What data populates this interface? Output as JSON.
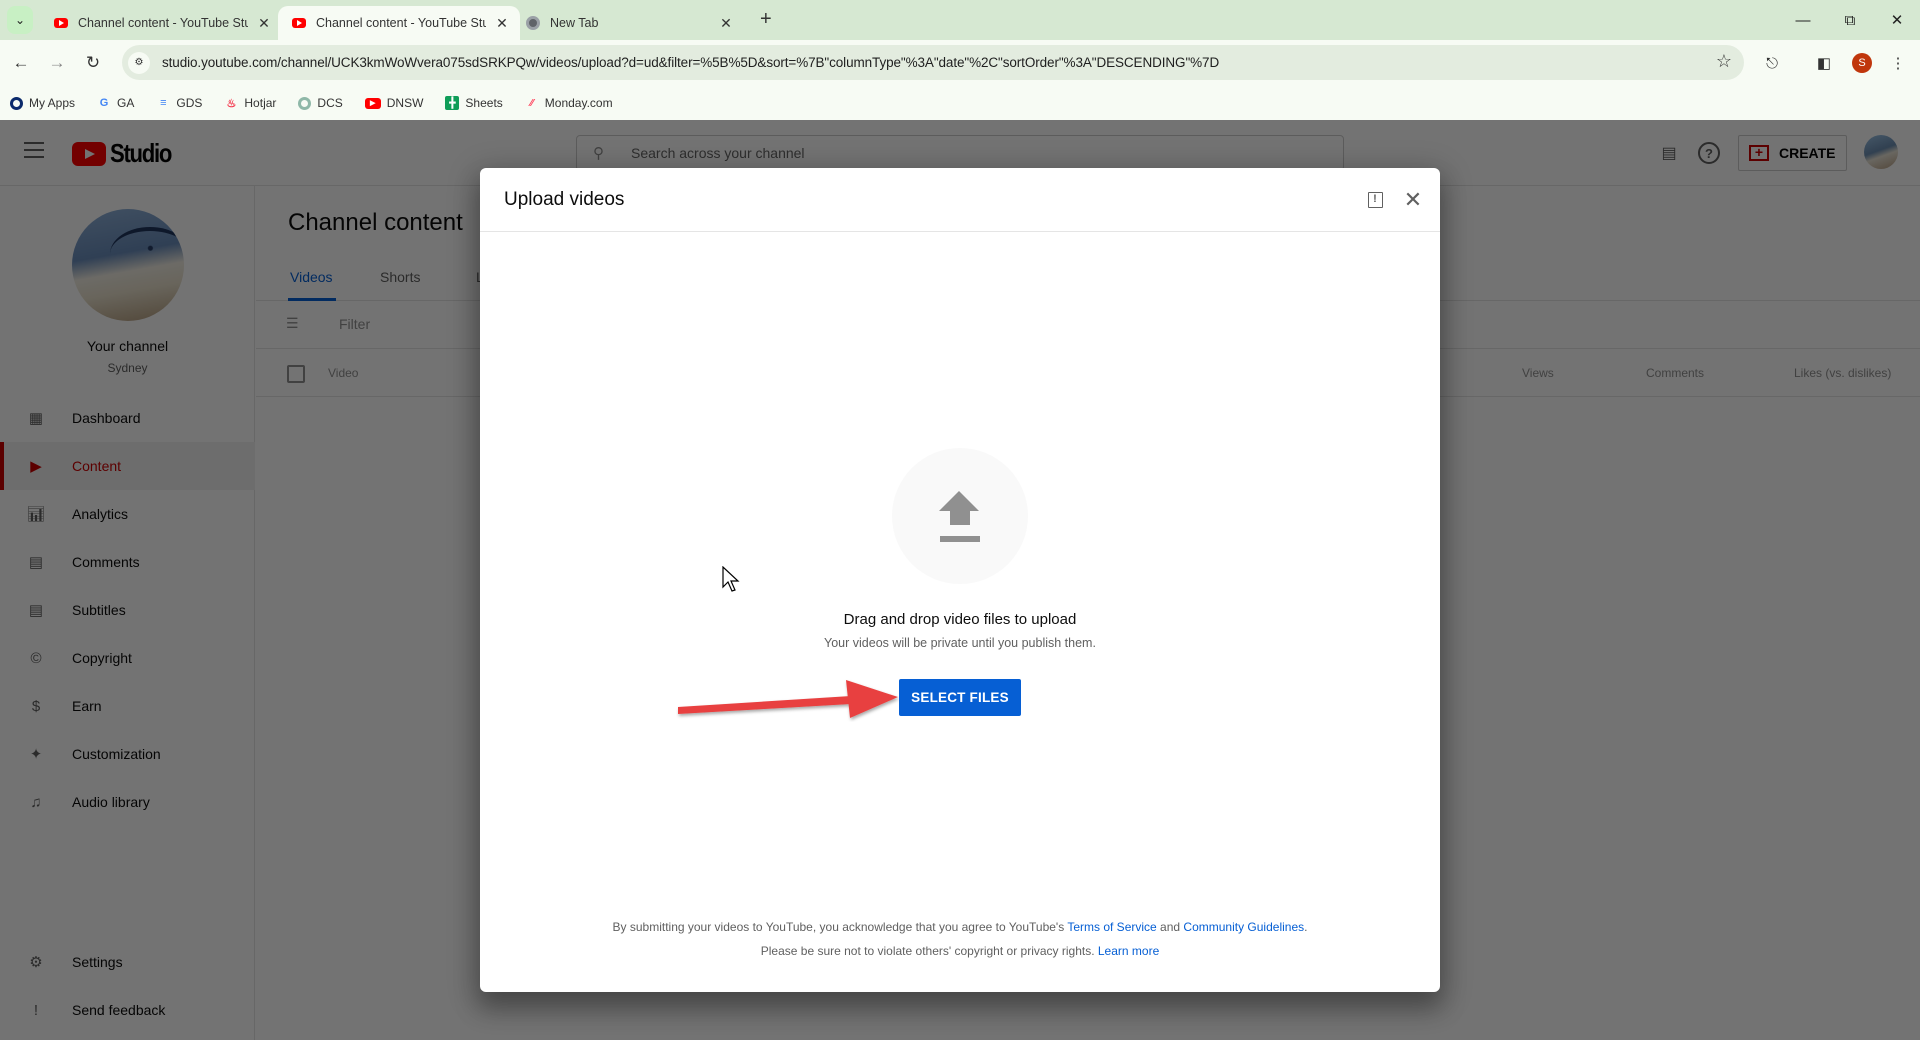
{
  "browser": {
    "tabs": [
      {
        "title": "Channel content - YouTube Stu",
        "favicon": "youtube-icon",
        "active": false
      },
      {
        "title": "Channel content - YouTube Stu",
        "favicon": "youtube-icon",
        "active": true
      },
      {
        "title": "New Tab",
        "favicon": "chrome-icon",
        "active": false
      }
    ],
    "url": "studio.youtube.com/channel/UCK3kmWoWvera075sdSRKPQw/videos/upload?d=ud&filter=%5B%5D&sort=%7B\"columnType\"%3A\"date\"%2C\"sortOrder\"%3A\"DESCENDING\"%7D",
    "profile_initial": "S",
    "profile_color": "#c0360c",
    "bookmarks": [
      {
        "label": "My Apps",
        "icon": "my-apps-icon"
      },
      {
        "label": "GA",
        "icon": "google-icon"
      },
      {
        "label": "GDS",
        "icon": "gds-icon"
      },
      {
        "label": "Hotjar",
        "icon": "hotjar-icon"
      },
      {
        "label": "DCS",
        "icon": "dcs-icon"
      },
      {
        "label": "DNSW",
        "icon": "youtube-icon"
      },
      {
        "label": "Sheets",
        "icon": "sheets-icon"
      },
      {
        "label": "Monday.com",
        "icon": "monday-icon"
      }
    ]
  },
  "header": {
    "logo_text": "Studio",
    "search_placeholder": "Search across your channel",
    "create_label": "CREATE"
  },
  "sidebar": {
    "channel_name": "Your channel",
    "channel_subtitle": "Sydney",
    "items": [
      {
        "label": "Dashboard",
        "icon": "dashboard-icon",
        "active": false
      },
      {
        "label": "Content",
        "icon": "content-icon",
        "active": true
      },
      {
        "label": "Analytics",
        "icon": "analytics-icon",
        "active": false
      },
      {
        "label": "Comments",
        "icon": "comments-icon",
        "active": false
      },
      {
        "label": "Subtitles",
        "icon": "subtitles-icon",
        "active": false
      },
      {
        "label": "Copyright",
        "icon": "copyright-icon",
        "active": false
      },
      {
        "label": "Earn",
        "icon": "dollar-icon",
        "active": false
      },
      {
        "label": "Customization",
        "icon": "magic-wand-icon",
        "active": false
      },
      {
        "label": "Audio library",
        "icon": "audio-library-icon",
        "active": false
      }
    ],
    "bottom_items": [
      {
        "label": "Settings",
        "icon": "gear-icon"
      },
      {
        "label": "Send feedback",
        "icon": "feedback-icon"
      }
    ]
  },
  "main": {
    "title": "Channel content",
    "tabs": [
      {
        "label": "Videos",
        "active": true
      },
      {
        "label": "Shorts",
        "active": false
      },
      {
        "label": "L",
        "active": false
      }
    ],
    "filter_placeholder": "Filter",
    "columns": [
      "Video",
      "Views",
      "Comments",
      "Likes (vs. dislikes)"
    ]
  },
  "modal": {
    "title": "Upload videos",
    "drag_text": "Drag and drop video files to upload",
    "private_text": "Your videos will be private until you publish them.",
    "select_button": "SELECT FILES",
    "legal_prefix": "By submitting your videos to YouTube, you acknowledge that you agree to YouTube's ",
    "terms_link": "Terms of Service",
    "and_text": " and ",
    "guidelines_link": "Community Guidelines",
    "legal_suffix": ".",
    "legal2_text": "Please be sure not to violate others' copyright or privacy rights. ",
    "learn_more_link": "Learn more"
  },
  "colors": {
    "accent_blue": "#065fd4",
    "youtube_red": "#ff0000",
    "annotation_arrow": "#e8413f"
  }
}
